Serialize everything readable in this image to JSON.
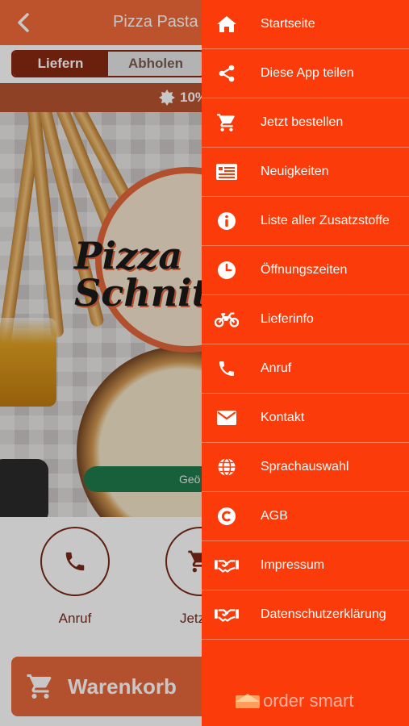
{
  "header": {
    "title": "Pizza Pasta S",
    "back_icon": "chevron-left-icon"
  },
  "order_mode": {
    "options": [
      "Liefern",
      "Abholen"
    ],
    "selected": "Liefern"
  },
  "promo": {
    "text": "10%",
    "icon": "badge-icon"
  },
  "hero": {
    "logo_line1": "Pizza",
    "logo_line2": "Schnit",
    "status": "Geö"
  },
  "actions": [
    {
      "label": "Anruf",
      "icon": "phone-icon"
    },
    {
      "label": "Jetzt b",
      "icon": "cart-icon"
    }
  ],
  "cart_button": {
    "label": "Warenkorb",
    "icon": "cart-icon"
  },
  "drawer": {
    "items": [
      {
        "label": "Startseite",
        "icon": "home-icon"
      },
      {
        "label": "Diese App teilen",
        "icon": "share-icon"
      },
      {
        "label": "Jetzt bestellen",
        "icon": "cart-icon"
      },
      {
        "label": "Neuigkeiten",
        "icon": "news-icon"
      },
      {
        "label": "Liste aller Zusatzstoffe",
        "icon": "info-icon"
      },
      {
        "label": "Öffnungszeiten",
        "icon": "clock-icon"
      },
      {
        "label": "Lieferinfo",
        "icon": "motorbike-icon"
      },
      {
        "label": "Anruf",
        "icon": "phone-icon"
      },
      {
        "label": "Kontakt",
        "icon": "envelope-icon"
      },
      {
        "label": "Sprachauswahl",
        "icon": "globe-icon"
      },
      {
        "label": "AGB",
        "icon": "copyright-icon"
      },
      {
        "label": "Impressum",
        "icon": "handshake-icon"
      },
      {
        "label": "Datenschutzerklärung",
        "icon": "handshake-icon"
      }
    ],
    "brand": "order smart"
  },
  "colors": {
    "drawer_bg": "#fb3c0a",
    "header_bg": "#f26b3a",
    "accent_dark": "#8a2a12",
    "open_green": "#1f7a4d"
  }
}
